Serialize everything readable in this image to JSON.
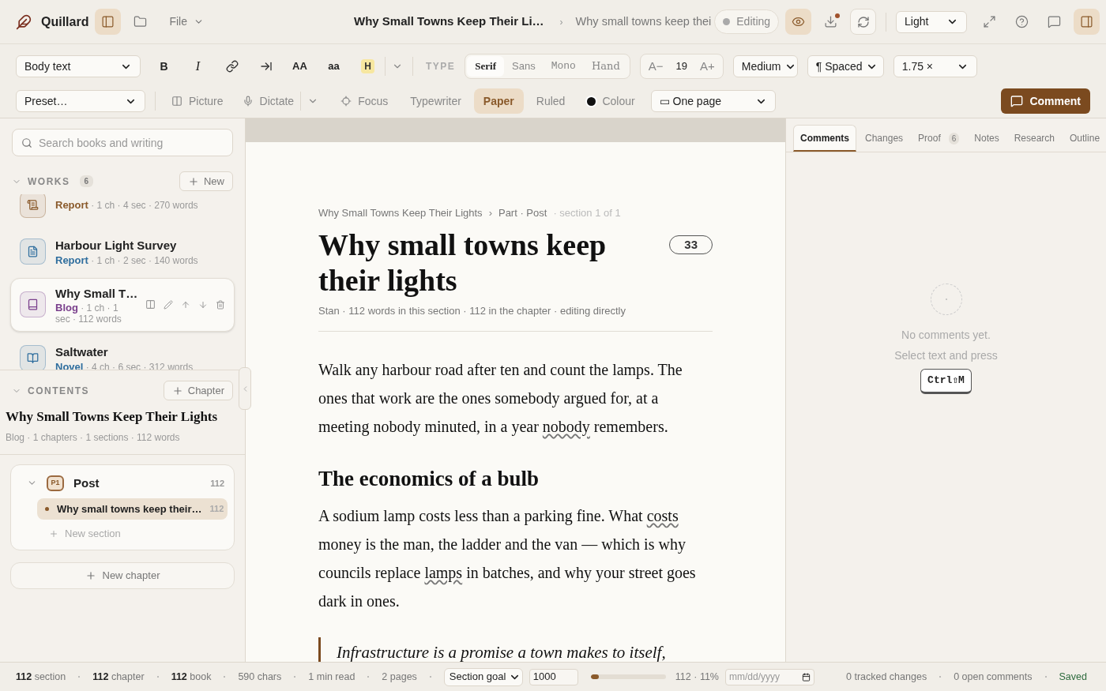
{
  "app": {
    "name": "Quillard"
  },
  "topbar": {
    "sidebar_toggle": {
      "selected": true
    },
    "menu": "File",
    "doc_title": "Why Small Towns Keep Their Li…",
    "separator": "›",
    "breadcrumb": "Why small towns keep thei",
    "mode": "Editing",
    "preview": {
      "selected": true
    },
    "download": {
      "notify": true
    },
    "theme": "Light",
    "panel_toggle": {
      "selected": true
    }
  },
  "format_bar": {
    "block_style": "Body text",
    "marks": [
      {
        "kind": "bold",
        "label": "B"
      },
      {
        "kind": "italic",
        "label": "I"
      },
      {
        "kind": "link"
      },
      {
        "kind": "indent"
      },
      {
        "kind": "caps",
        "label": "AA"
      },
      {
        "kind": "lower",
        "label": "aa"
      },
      {
        "kind": "highlight",
        "label": "H"
      }
    ],
    "type_label": "TYPE",
    "fonts": [
      {
        "label": "Serif",
        "selected": true
      },
      {
        "label": "Sans",
        "selected": false
      },
      {
        "label": "Mono",
        "selected": false
      },
      {
        "label": "Hand",
        "selected": false
      }
    ],
    "size_down": "A−",
    "size": "19",
    "size_up": "A+",
    "weight": "Medium",
    "spacing": "¶ Spaced",
    "line_height": "1.75 ×"
  },
  "view_bar": {
    "preset": "Preset…",
    "picture": "Picture",
    "dictate": "Dictate",
    "modes": [
      {
        "kind": "focus",
        "label": "Focus",
        "selected": false
      },
      {
        "kind": "plain",
        "label": "Typewriter",
        "selected": false
      },
      {
        "kind": "plain",
        "label": "Paper",
        "selected": true
      },
      {
        "kind": "plain",
        "label": "Ruled",
        "selected": false
      }
    ],
    "colour": {
      "label": "Colour",
      "color": "#111111"
    },
    "layout": "▭ One page",
    "comment": "Comment"
  },
  "sidebar": {
    "search": {
      "placeholder": "Search books and writing"
    },
    "works_label": "WORKS",
    "works_count": "6",
    "new": "New",
    "works": [
      {
        "kind": "report",
        "type": "Report",
        "color": "#8a5a2b",
        "meta": "· 1 ch · 4 sec · 270 words",
        "selected": false
      },
      {
        "kind": "doc",
        "title": "Harbour Light Survey",
        "type": "Report",
        "color": "#2f6e9e",
        "meta": "· 1 ch · 2 sec · 140 words",
        "selected": false
      },
      {
        "kind": "book",
        "title": "Why Small T…",
        "type": "Blog",
        "color": "#7a3f8c",
        "meta": "· 1 ch · 1 sec · 112 words",
        "selected": true
      },
      {
        "kind": "novel",
        "title": "Saltwater",
        "type": "Novel",
        "color": "#2f6e9e",
        "meta": "· 4 ch · 6 sec · 312 words",
        "selected": false
      }
    ],
    "contents_label": "CONTENTS",
    "add_chapter": "Chapter",
    "book_title": "Why Small Towns Keep Their Lights",
    "book_meta": "Blog · 1 chapters · 1 sections · 112 words",
    "chapters": [
      {
        "badge": "P1",
        "title": "Post",
        "count": "112",
        "expanded": true,
        "sections": [
          {
            "title": "Why small towns keep their…",
            "count": "112",
            "selected": true
          }
        ],
        "new_section": "New section"
      }
    ],
    "new_chapter": "New chapter"
  },
  "editor": {
    "crumbs": "Why Small Towns Keep Their Lights",
    "crumb_sep": "›",
    "crumb_part": "Part · Post",
    "crumb_section": "· section 1 of 1",
    "title": "Why small towns keep their lights",
    "title_count": "33",
    "byline": "Stan · 112 words in this section · 112 in the chapter · editing directly",
    "blocks": [
      {
        "kind": "paragraph",
        "segments": [
          {
            "text": "Walk any harbour road after ten and count the lamps. The ones that work are the ones somebody argued for, at a meeting nobody minuted, in a year ",
            "flagged": false
          },
          {
            "text": "nobody",
            "flagged": true
          },
          {
            "text": " remembers.",
            "flagged": false
          }
        ]
      },
      {
        "kind": "heading",
        "text": "The economics of a bulb"
      },
      {
        "kind": "paragraph",
        "segments": [
          {
            "text": "A sodium lamp costs less than a parking fine. What ",
            "flagged": false
          },
          {
            "text": "costs",
            "flagged": true
          },
          {
            "text": " money is the man, the ladder and the van — which is why councils replace ",
            "flagged": false
          },
          {
            "text": "lamps",
            "flagged": true
          },
          {
            "text": " in batches, and why your street goes dark in ones.",
            "flagged": false
          }
        ]
      },
      {
        "kind": "quote",
        "text": "Infrastructure is a promise a town makes to itself,"
      }
    ]
  },
  "right_panel": {
    "tabs": [
      {
        "label": "Comments",
        "selected": true
      },
      {
        "label": "Changes",
        "selected": false
      },
      {
        "label": "Proof",
        "badge": "6",
        "selected": false
      },
      {
        "label": "Notes",
        "selected": false
      },
      {
        "label": "Research",
        "selected": false
      },
      {
        "label": "Outline",
        "selected": false
      }
    ],
    "empty_title": "No comments yet.",
    "empty_hint": "Select text and press",
    "shortcut": "Ctrl⇧M"
  },
  "status_bar": {
    "counts": [
      {
        "number": "112",
        "label": "section"
      },
      {
        "number": "112",
        "label": "chapter"
      },
      {
        "number": "112",
        "label": "book"
      }
    ],
    "stats": [
      "590 chars",
      "1 min read",
      "2 pages"
    ],
    "goal_type": "Section goal",
    "goal": "1000",
    "goal_progress": {
      "level": 0.11
    },
    "goal_reading": "112 · 11%",
    "date_placeholder": "mm/dd/yyyy",
    "changes": "0 tracked changes",
    "comments": "0 open comments",
    "saved": "Saved"
  }
}
